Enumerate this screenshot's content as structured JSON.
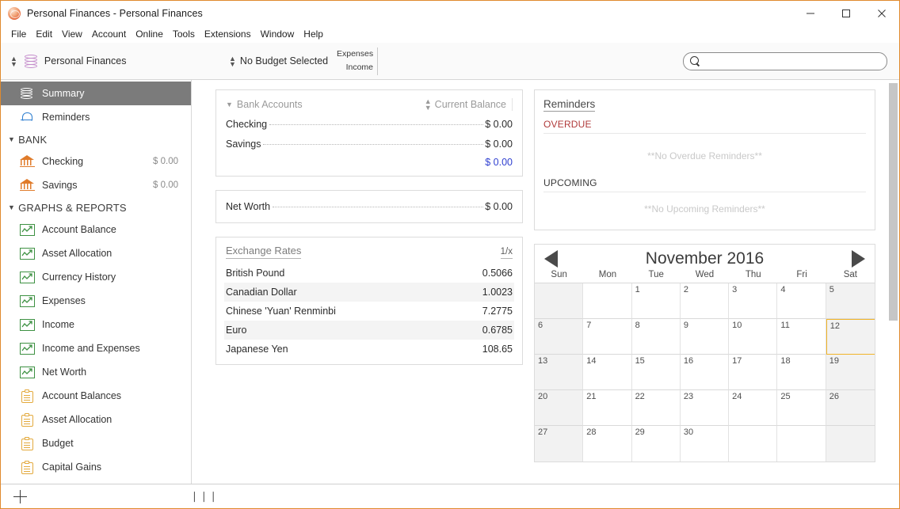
{
  "window": {
    "title": "Personal Finances - Personal Finances",
    "app_icon": "coins-icon",
    "controls": {
      "minimize": "—",
      "maximize": "☐",
      "close": "✕"
    },
    "accent_color": "#e08a2e"
  },
  "menubar": {
    "items": [
      "File",
      "Edit",
      "View",
      "Account",
      "Online",
      "Tools",
      "Extensions",
      "Window",
      "Help"
    ]
  },
  "toolbar": {
    "ledger_label": "Personal Finances",
    "budget_label": "No Budget Selected",
    "expenses_label": "Expenses",
    "income_label": "Income",
    "search": {
      "value": "",
      "placeholder": ""
    }
  },
  "sidebar": {
    "items": [
      {
        "label": "Summary",
        "icon": "coins-icon",
        "selected": true,
        "type": "item"
      },
      {
        "label": "Reminders",
        "icon": "bell-icon",
        "selected": false,
        "type": "item"
      },
      {
        "label": "BANK",
        "type": "group",
        "expanded": true
      },
      {
        "label": "Checking",
        "icon": "bank-icon",
        "amount": "$ 0.00",
        "type": "item"
      },
      {
        "label": "Savings",
        "icon": "bank-icon",
        "amount": "$ 0.00",
        "type": "item"
      },
      {
        "label": "GRAPHS & REPORTS",
        "type": "group",
        "expanded": true
      },
      {
        "label": "Account Balance",
        "icon": "graph-icon",
        "type": "item"
      },
      {
        "label": "Asset Allocation",
        "icon": "graph-icon",
        "type": "item"
      },
      {
        "label": "Currency History",
        "icon": "graph-icon",
        "type": "item"
      },
      {
        "label": "Expenses",
        "icon": "graph-icon",
        "type": "item"
      },
      {
        "label": "Income",
        "icon": "graph-icon",
        "type": "item"
      },
      {
        "label": "Income and Expenses",
        "icon": "graph-icon",
        "type": "item"
      },
      {
        "label": "Net Worth",
        "icon": "graph-icon",
        "type": "item"
      },
      {
        "label": "Account Balances",
        "icon": "report-icon",
        "type": "item"
      },
      {
        "label": "Asset Allocation",
        "icon": "report-icon",
        "type": "item"
      },
      {
        "label": "Budget",
        "icon": "report-icon",
        "type": "item"
      },
      {
        "label": "Capital Gains",
        "icon": "report-icon",
        "type": "item",
        "clipped": true
      }
    ]
  },
  "bank_accounts": {
    "title": "Bank Accounts",
    "sort_label": "Current Balance",
    "rows": [
      {
        "name": "Checking",
        "amount": "$ 0.00"
      },
      {
        "name": "Savings",
        "amount": "$ 0.00"
      }
    ],
    "total": "$ 0.00",
    "total_color": "#2f3fd0"
  },
  "net_worth": {
    "label": "Net Worth",
    "amount": "$ 0.00"
  },
  "exchange_rates": {
    "title": "Exchange Rates",
    "unit_header": "1/x",
    "rows": [
      {
        "currency": "British Pound",
        "rate": "0.5066"
      },
      {
        "currency": "Canadian Dollar",
        "rate": "1.0023"
      },
      {
        "currency": "Chinese 'Yuan' Renminbi",
        "rate": "7.2775"
      },
      {
        "currency": "Euro",
        "rate": "0.6785"
      },
      {
        "currency": "Japanese Yen",
        "rate": "108.65"
      }
    ]
  },
  "reminders": {
    "title": "Reminders",
    "overdue_label": "OVERDUE",
    "overdue_empty": "**No Overdue Reminders**",
    "upcoming_label": "UPCOMING",
    "upcoming_empty": "**No Upcoming Reminders**",
    "overdue_color": "#b03a3a"
  },
  "calendar": {
    "title": "November 2016",
    "prev_label": "◀",
    "next_label": "▶",
    "day_headers": [
      "Sun",
      "Mon",
      "Tue",
      "Wed",
      "Thu",
      "Fri",
      "Sat"
    ],
    "today": 12,
    "today_border_color": "#f0b429",
    "weeks": [
      [
        "",
        "",
        "1",
        "2",
        "3",
        "4",
        "5"
      ],
      [
        "6",
        "7",
        "8",
        "9",
        "10",
        "11",
        "12"
      ],
      [
        "13",
        "14",
        "15",
        "16",
        "17",
        "18",
        "19"
      ],
      [
        "20",
        "21",
        "22",
        "23",
        "24",
        "25",
        "26"
      ],
      [
        "27",
        "28",
        "29",
        "30",
        "",
        "",
        ""
      ]
    ]
  },
  "statusbar": {
    "add_icon": "plus-icon",
    "grip": "❘❘❘"
  }
}
